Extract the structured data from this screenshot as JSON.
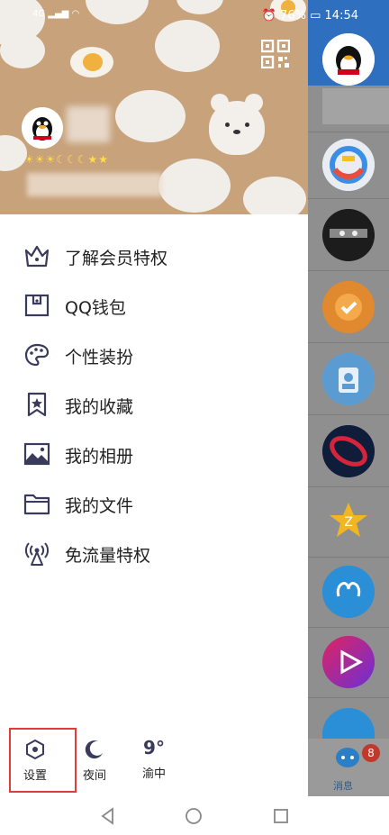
{
  "status_bar": {
    "signal": "4G",
    "battery": "76%",
    "time": "14:54"
  },
  "menu": [
    {
      "label": "了解会员特权",
      "icon": "crown-icon"
    },
    {
      "label": "QQ钱包",
      "icon": "wallet-icon"
    },
    {
      "label": "个性装扮",
      "icon": "palette-icon"
    },
    {
      "label": "我的收藏",
      "icon": "bookmark-star-icon"
    },
    {
      "label": "我的相册",
      "icon": "photo-album-icon"
    },
    {
      "label": "我的文件",
      "icon": "folder-icon"
    },
    {
      "label": "免流量特权",
      "icon": "signal-tower-icon"
    }
  ],
  "bottom": {
    "settings_label": "设置",
    "night_label": "夜间",
    "weather_temp": "9°",
    "weather_city": "渝中"
  },
  "right_panel": {
    "message_tab_label": "消息",
    "badge_count": "8"
  },
  "colors": {
    "accent": "#2f6fbf",
    "highlight": "#e23b3b",
    "header_bg": "#c7a27b"
  }
}
